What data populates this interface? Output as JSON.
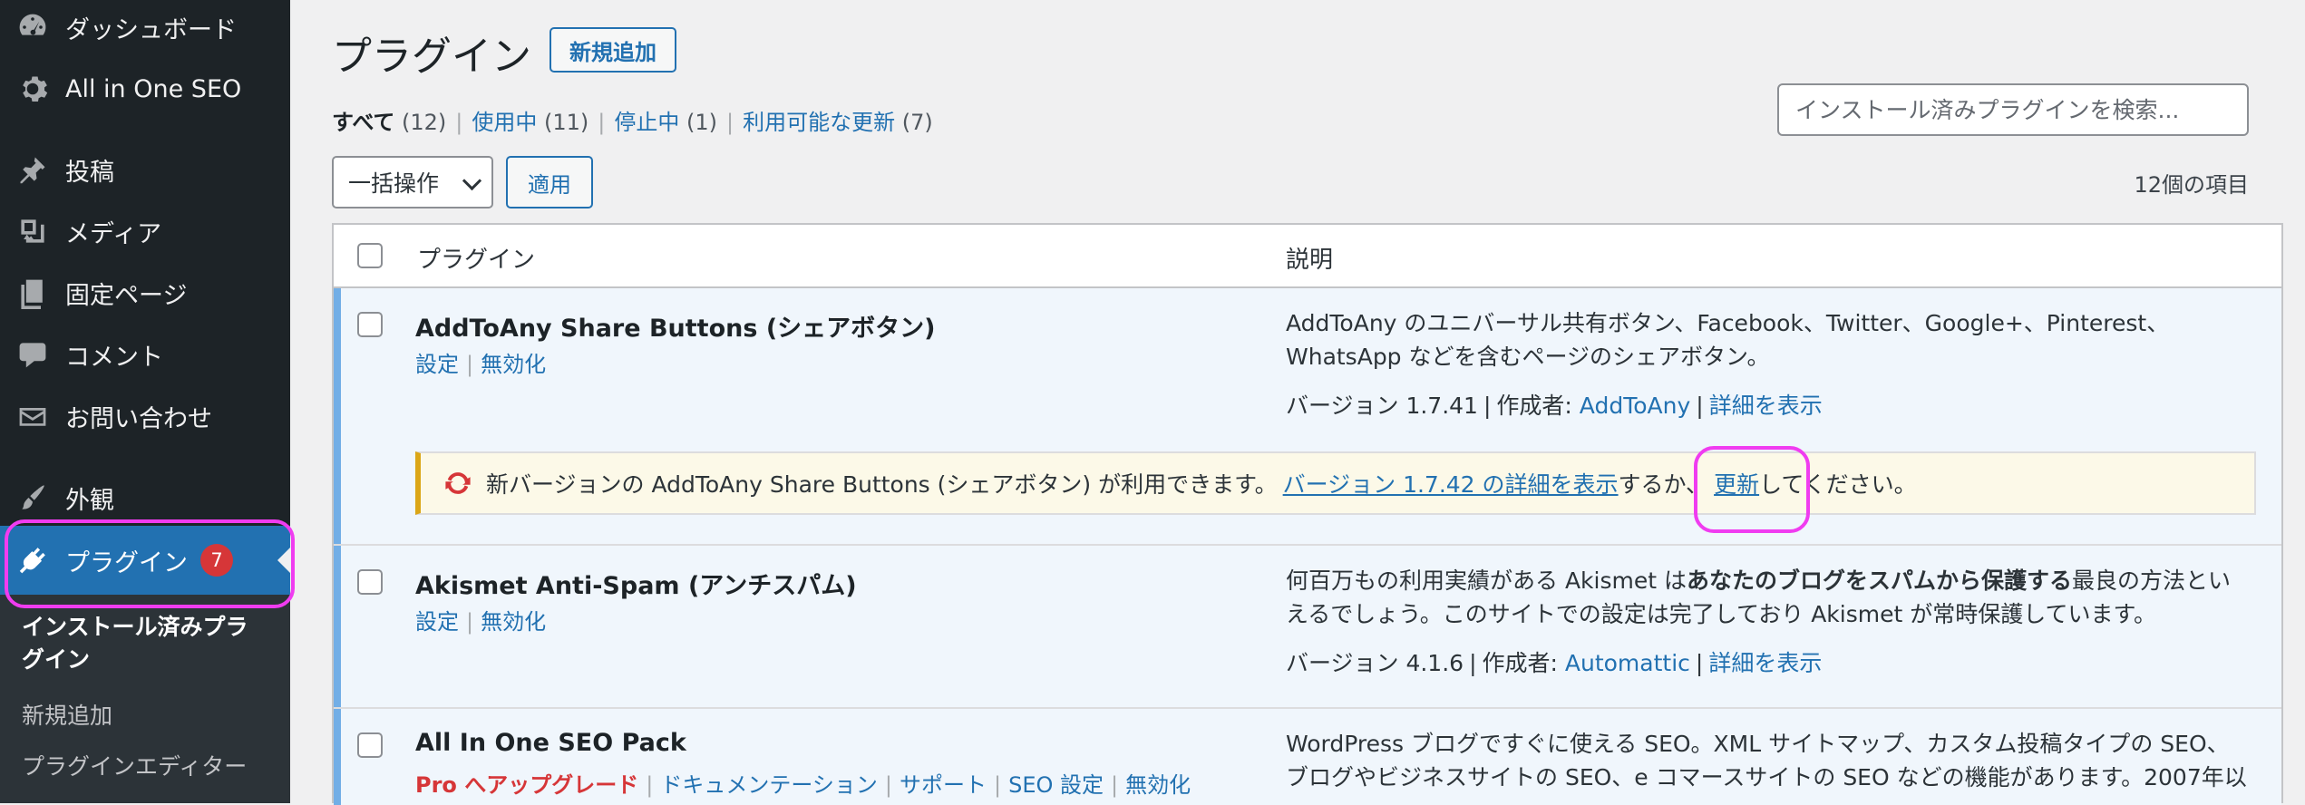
{
  "sidebar": {
    "items": [
      {
        "label": "ダッシュボード",
        "icon": "dashboard-icon"
      },
      {
        "label": "All in One SEO",
        "icon": "gear-icon"
      },
      {
        "label": "投稿",
        "icon": "pin-icon"
      },
      {
        "label": "メディア",
        "icon": "media-icon"
      },
      {
        "label": "固定ページ",
        "icon": "pages-icon"
      },
      {
        "label": "コメント",
        "icon": "comment-icon"
      },
      {
        "label": "お問い合わせ",
        "icon": "mail-icon"
      },
      {
        "label": "外観",
        "icon": "paintbrush-icon"
      },
      {
        "label": "プラグイン",
        "icon": "plugin-icon",
        "badge": "7"
      }
    ],
    "submenu": {
      "installed_line1": "インストール済みプラ",
      "installed_line2": "グイン",
      "add_new": "新規追加",
      "editor": "プラグインエディター"
    }
  },
  "header": {
    "title": "プラグイン",
    "add_new": "新規追加"
  },
  "filters": {
    "all": "すべて",
    "all_count": "(12)",
    "active": "使用中",
    "active_count": "(11)",
    "inactive": "停止中",
    "inactive_count": "(1)",
    "updates": "利用可能な更新",
    "updates_count": "(7)"
  },
  "search": {
    "placeholder": "インストール済みプラグインを検索..."
  },
  "bulk": {
    "label": "一括操作",
    "apply": "適用"
  },
  "items_count": "12個の項目",
  "table": {
    "col_plugin": "プラグイン",
    "col_desc": "説明",
    "rows": [
      {
        "name": "AddToAny Share Buttons (シェアボタン)",
        "action_settings": "設定",
        "action_deactivate": "無効化",
        "desc_line1": "AddToAny のユニバーサル共有ボタン、Facebook、Twitter、Google+、Pinterest、",
        "desc_line2": "WhatsApp などを含むページのシェアボタン。",
        "version": "バージョン 1.7.41",
        "author_label": "作成者:",
        "author": "AddToAny",
        "details": "詳細を表示",
        "notice": {
          "text1": "新バージョンの AddToAny Share Buttons (シェアボタン) が利用できます。",
          "link_details": "バージョン 1.7.42 の詳細を表示",
          "text2": "するか、",
          "link_update": "更新",
          "text3": "してください。"
        }
      },
      {
        "name": "Akismet Anti-Spam (アンチスパム)",
        "action_settings": "設定",
        "action_deactivate": "無効化",
        "desc_pre": "何百万もの利用実績がある Akismet は",
        "desc_bold": "あなたのブログをスパムから保護する",
        "desc_post": "最良の方法とい",
        "desc_line2": "えるでしょう。このサイトでの設定は完了しており Akismet が常時保護しています。",
        "version": "バージョン 4.1.6",
        "author_label": "作成者:",
        "author": "Automattic",
        "details": "詳細を表示"
      },
      {
        "name": "All In One SEO Pack",
        "action_pro": "Pro へアップグレード",
        "action_docs": "ドキュメンテーション",
        "action_support": "サポート",
        "action_seo": "SEO 設定",
        "action_deactivate": "無効化",
        "desc_line1": "WordPress ブログですぐに使える SEO。XML サイトマップ、カスタム投稿タイプの SEO、",
        "desc_line2": "ブログやビジネスサイトの SEO、e コマースサイトの SEO などの機能があります。2007年以"
      }
    ]
  },
  "colors": {
    "accent": "#2271b1",
    "sidebar_bg": "#1d2327",
    "badge": "#d63638",
    "notice_border": "#dba617",
    "highlight": "#f03cf0"
  }
}
